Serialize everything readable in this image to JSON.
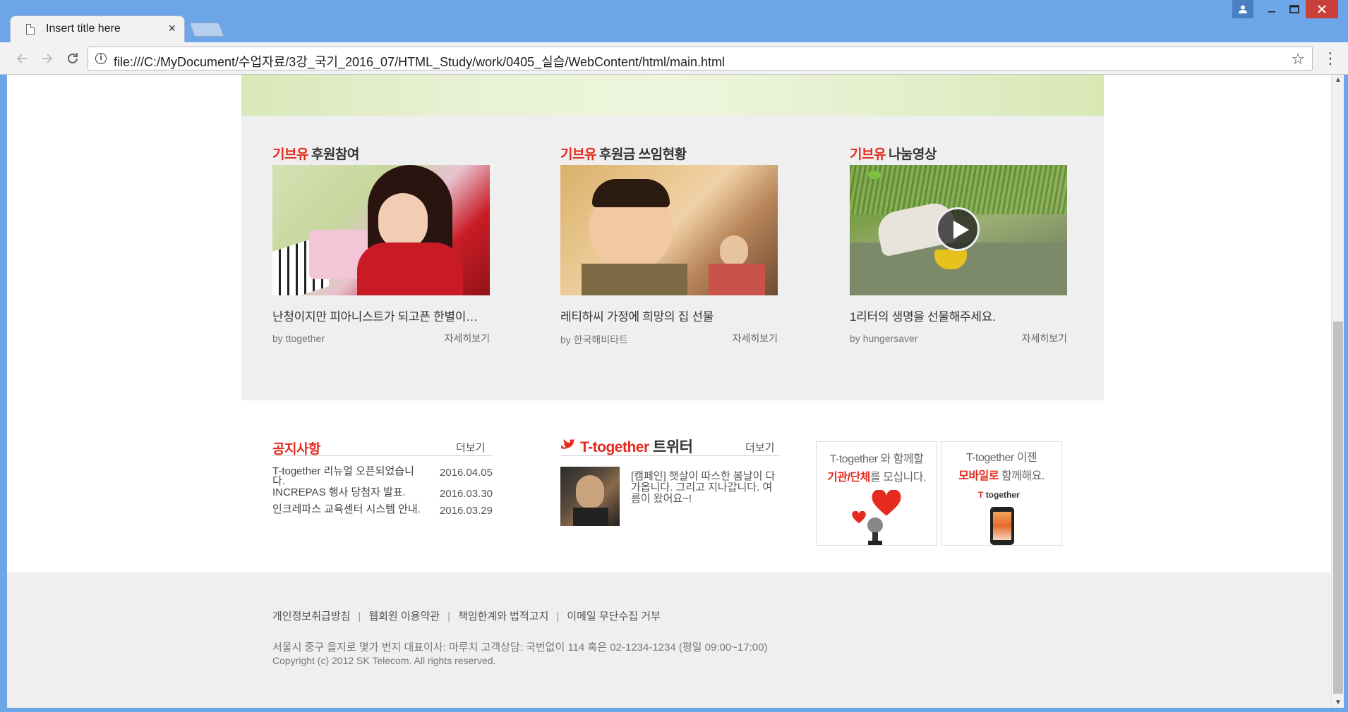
{
  "browser": {
    "tab_title": "Insert title here",
    "url": "file:///C:/MyDocument/수업자료/3강_국기_2016_07/HTML_Study/work/0405_실습/WebContent/html/main.html"
  },
  "brand": "기브유",
  "cards": [
    {
      "title": "후원참여",
      "text": "난청이지만 피아니스트가 되고픈 한별이…",
      "by": "by ttogether",
      "more": "자세히보기",
      "image": "girl-playing-piano"
    },
    {
      "title": "후원금 쓰임현황",
      "text": "레티하씨 가정에 희망의 집 선물",
      "by": "by 한국해비타트",
      "more": "자세히보기",
      "image": "smiling-child"
    },
    {
      "title": "나눔영상",
      "text": "1리터의 생명을 선물해주세요.",
      "by": "by hungersaver",
      "more": "자세히보기",
      "image": "boy-at-water-video"
    }
  ],
  "notice": {
    "title": "공지사항",
    "more": "더보기",
    "items": [
      {
        "title": "T-together 리뉴얼 오픈되었습니다.",
        "date": "2016.04.05"
      },
      {
        "title": "INCREPAS 행사 당첨자 발표.",
        "date": "2016.03.30"
      },
      {
        "title": "인크레파스 교육센터 시스템 안내.",
        "date": "2016.03.29"
      }
    ]
  },
  "twitter": {
    "title_brand": "T-together",
    "title_rest": "트위터",
    "more": "더보기",
    "text": "[캠페인] 햇살이 따스한 봄날이 다가옵니다. 그리고 지나갑니다. 여름이 왔어요~!"
  },
  "banners": [
    {
      "line1": "T-together 와 함께할",
      "line2_hl": "기관/단체",
      "line2_rest": "를 모십니다."
    },
    {
      "line1": "T-together 이젠",
      "line2_hl": "모바일로",
      "line2_rest": " 함께해요.",
      "logo": "together"
    }
  ],
  "footer": {
    "links": [
      "개인정보취급방침",
      "웹회원 이용약관",
      "책임한계와 법적고지",
      "이메일 무단수집 거부"
    ],
    "address": "서울시 중구 을지로 몇가 번지 대표이사: 마루치 고객상담: 국번없이 114 혹은 02-1234-1234 (평일 09:00~17:00)",
    "copyright": "Copyright (c) 2012 SK Telecom. All rights reserved."
  },
  "colors": {
    "accent": "#e52a1f",
    "panel": "#efefef",
    "chrome": "#6da6e8"
  }
}
